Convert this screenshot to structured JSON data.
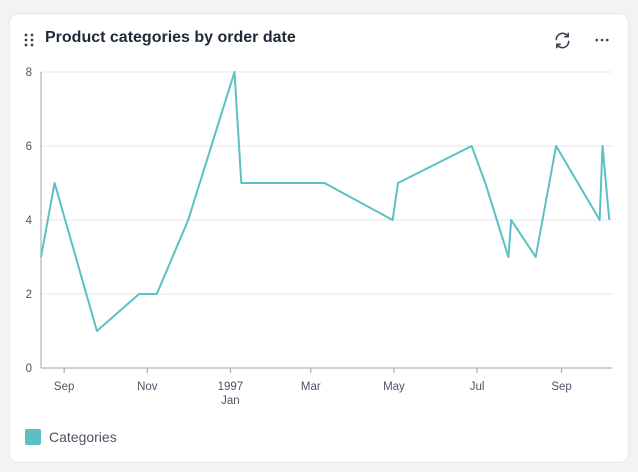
{
  "header": {
    "title": "Product categories by order date",
    "icons": {
      "drag": "drag-handle-icon",
      "refresh": "refresh-icon",
      "more": "more-horizontal-icon"
    }
  },
  "colors": {
    "series": "#5bc0c4",
    "grid": "#e5e7eb",
    "axis": "#9ca3af",
    "text": "#4b5563"
  },
  "chart_data": {
    "type": "line",
    "title": "Product categories by order date",
    "xlabel": "",
    "ylabel": "",
    "ylim": [
      0,
      8
    ],
    "xlim": [
      "1996-08-15",
      "1997-10-08"
    ],
    "yticks": [
      0,
      2,
      4,
      6,
      8
    ],
    "xticks": [
      {
        "date": "1996-09-01",
        "label": "Sep",
        "sublabel": ""
      },
      {
        "date": "1996-11-01",
        "label": "Nov",
        "sublabel": ""
      },
      {
        "date": "1997-01-01",
        "label": "1997",
        "sublabel": "Jan"
      },
      {
        "date": "1997-03-01",
        "label": "Mar",
        "sublabel": ""
      },
      {
        "date": "1997-05-01",
        "label": "May",
        "sublabel": ""
      },
      {
        "date": "1997-07-01",
        "label": "Jul",
        "sublabel": ""
      },
      {
        "date": "1997-09-01",
        "label": "Sep",
        "sublabel": ""
      }
    ],
    "grid": true,
    "legend": "bottom-left",
    "series": [
      {
        "name": "Categories",
        "x": [
          "1996-08-15",
          "1996-08-25",
          "1996-09-25",
          "1996-10-26",
          "1996-11-01",
          "1996-11-08",
          "1996-12-01",
          "1997-01-04",
          "1997-01-09",
          "1997-03-01",
          "1997-03-11",
          "1997-04-30",
          "1997-05-04",
          "1997-06-27",
          "1997-07-07",
          "1997-07-24",
          "1997-07-26",
          "1997-08-13",
          "1997-08-28",
          "1997-09-29",
          "1997-10-01",
          "1997-10-06"
        ],
        "values": [
          3,
          5,
          1,
          2,
          2,
          2,
          4,
          8,
          5,
          5,
          5,
          4,
          5,
          6,
          5,
          3,
          4,
          3,
          6,
          4,
          6,
          4
        ]
      }
    ]
  }
}
